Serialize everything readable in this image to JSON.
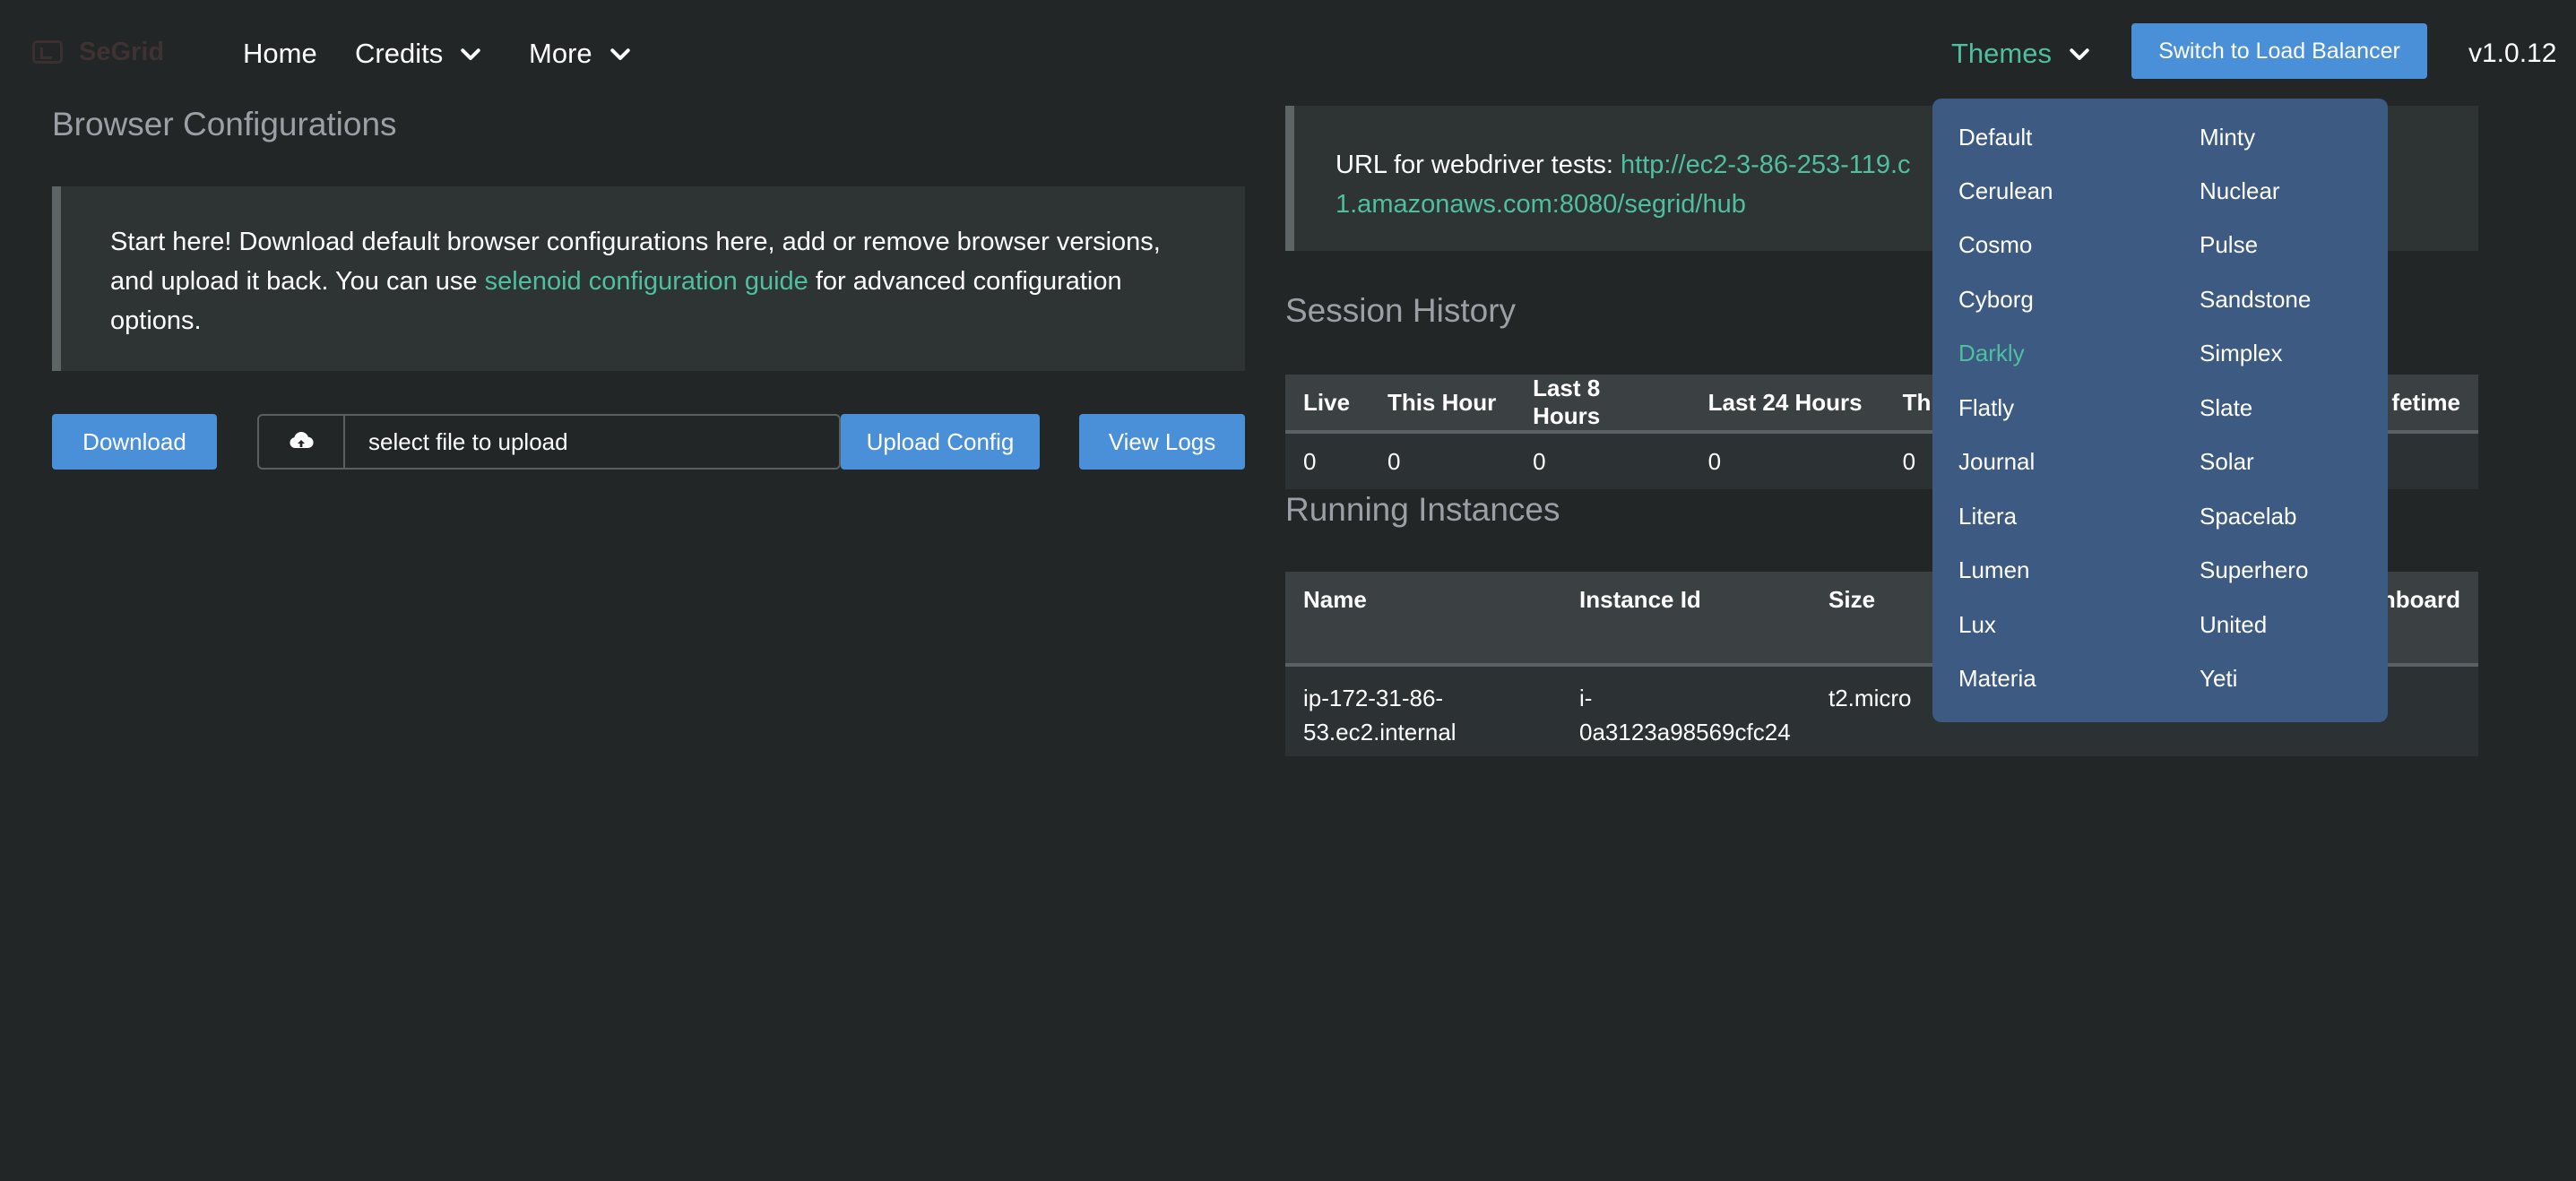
{
  "nav": {
    "brand": "SeGrid",
    "home": "Home",
    "credits": "Credits",
    "more": "More",
    "themes": "Themes",
    "load_balancer_button": "Switch to Load Balancer",
    "version": "v1.0.12"
  },
  "browser_config": {
    "title": "Browser Configurations",
    "note_prefix": "Start here! Download default browser configurations here, add or remove browser versions, and upload it back. You can use ",
    "note_link": "selenoid configuration guide",
    "note_suffix": " for advanced configuration options.",
    "download_label": "Download",
    "file_placeholder": "select file to upload",
    "upload_label": "Upload Config",
    "view_logs_label": "View Logs"
  },
  "webdriver": {
    "url_label": "URL for webdriver tests: ",
    "url_line1": "http://ec2-3-86-253-119.c",
    "url_line2": "1.amazonaws.com:8080/segrid/hub"
  },
  "session_history": {
    "title": "Session History",
    "headers": [
      "Live",
      "This Hour",
      "Last 8 Hours",
      "Last 24 Hours",
      "Th",
      "fetime"
    ],
    "values": [
      "0",
      "0",
      "0",
      "0",
      "0",
      ""
    ]
  },
  "running_instances": {
    "title": "Running Instances",
    "headers": [
      "Name",
      "Instance Id",
      "Size",
      "hboard"
    ],
    "rows": [
      {
        "name_line1": "ip-172-31-86-",
        "name_line2": "53.ec2.internal",
        "id_line1": "i-",
        "id_line2": "0a3123a98569cfc24",
        "size": "t2.micro"
      }
    ]
  },
  "themes_menu": {
    "left": [
      "Default",
      "Cerulean",
      "Cosmo",
      "Cyborg",
      "Darkly",
      "Flatly",
      "Journal",
      "Litera",
      "Lumen",
      "Lux",
      "Materia"
    ],
    "right": [
      "Minty",
      "Nuclear",
      "Pulse",
      "Sandstone",
      "Simplex",
      "Slate",
      "Solar",
      "Spacelab",
      "Superhero",
      "United",
      "Yeti"
    ],
    "active": "Darkly"
  },
  "colors": {
    "background": "#222627",
    "accent_green": "#4fbf9f",
    "button_blue": "#4a90d9",
    "dropdown_bg": "#3c5a82"
  },
  "icons": [
    "logo-icon",
    "chevron-down-icon",
    "cloud-upload-icon"
  ]
}
